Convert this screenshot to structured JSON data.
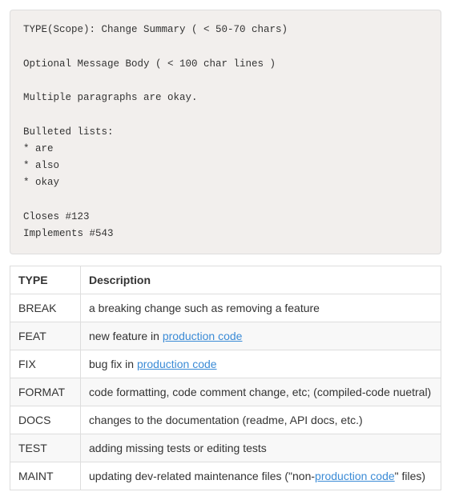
{
  "codeblock": {
    "l1": "TYPE(Scope): Change Summary ( < 50-70 chars)",
    "l2": "Optional Message Body ( < 100 char lines )",
    "l3": "Multiple paragraphs are okay.",
    "l4": "Bulleted lists:",
    "l5": "* are",
    "l6": "* also",
    "l7": "* okay",
    "l8": "Closes #123",
    "l9": "Implements #543"
  },
  "table": {
    "head_type": "TYPE",
    "head_desc": "Description",
    "rows": [
      {
        "type": "BREAK",
        "d1": "a breaking change such as removing a feature"
      },
      {
        "type": "FEAT",
        "d1": "new feature in ",
        "link": "production code",
        "d2": ""
      },
      {
        "type": "FIX",
        "d1": "bug fix in ",
        "link": "production code",
        "d2": ""
      },
      {
        "type": "FORMAT",
        "d1": "code formatting, code comment change, etc; (compiled-code nuetral)"
      },
      {
        "type": "DOCS",
        "d1": "changes to the documentation (readme, API docs, etc.)"
      },
      {
        "type": "TEST",
        "d1": "adding missing tests or editing tests"
      },
      {
        "type": "MAINT",
        "d1": "updating dev-related maintenance files (\"non-",
        "link": "production code",
        "d2": "\" files)"
      }
    ]
  }
}
